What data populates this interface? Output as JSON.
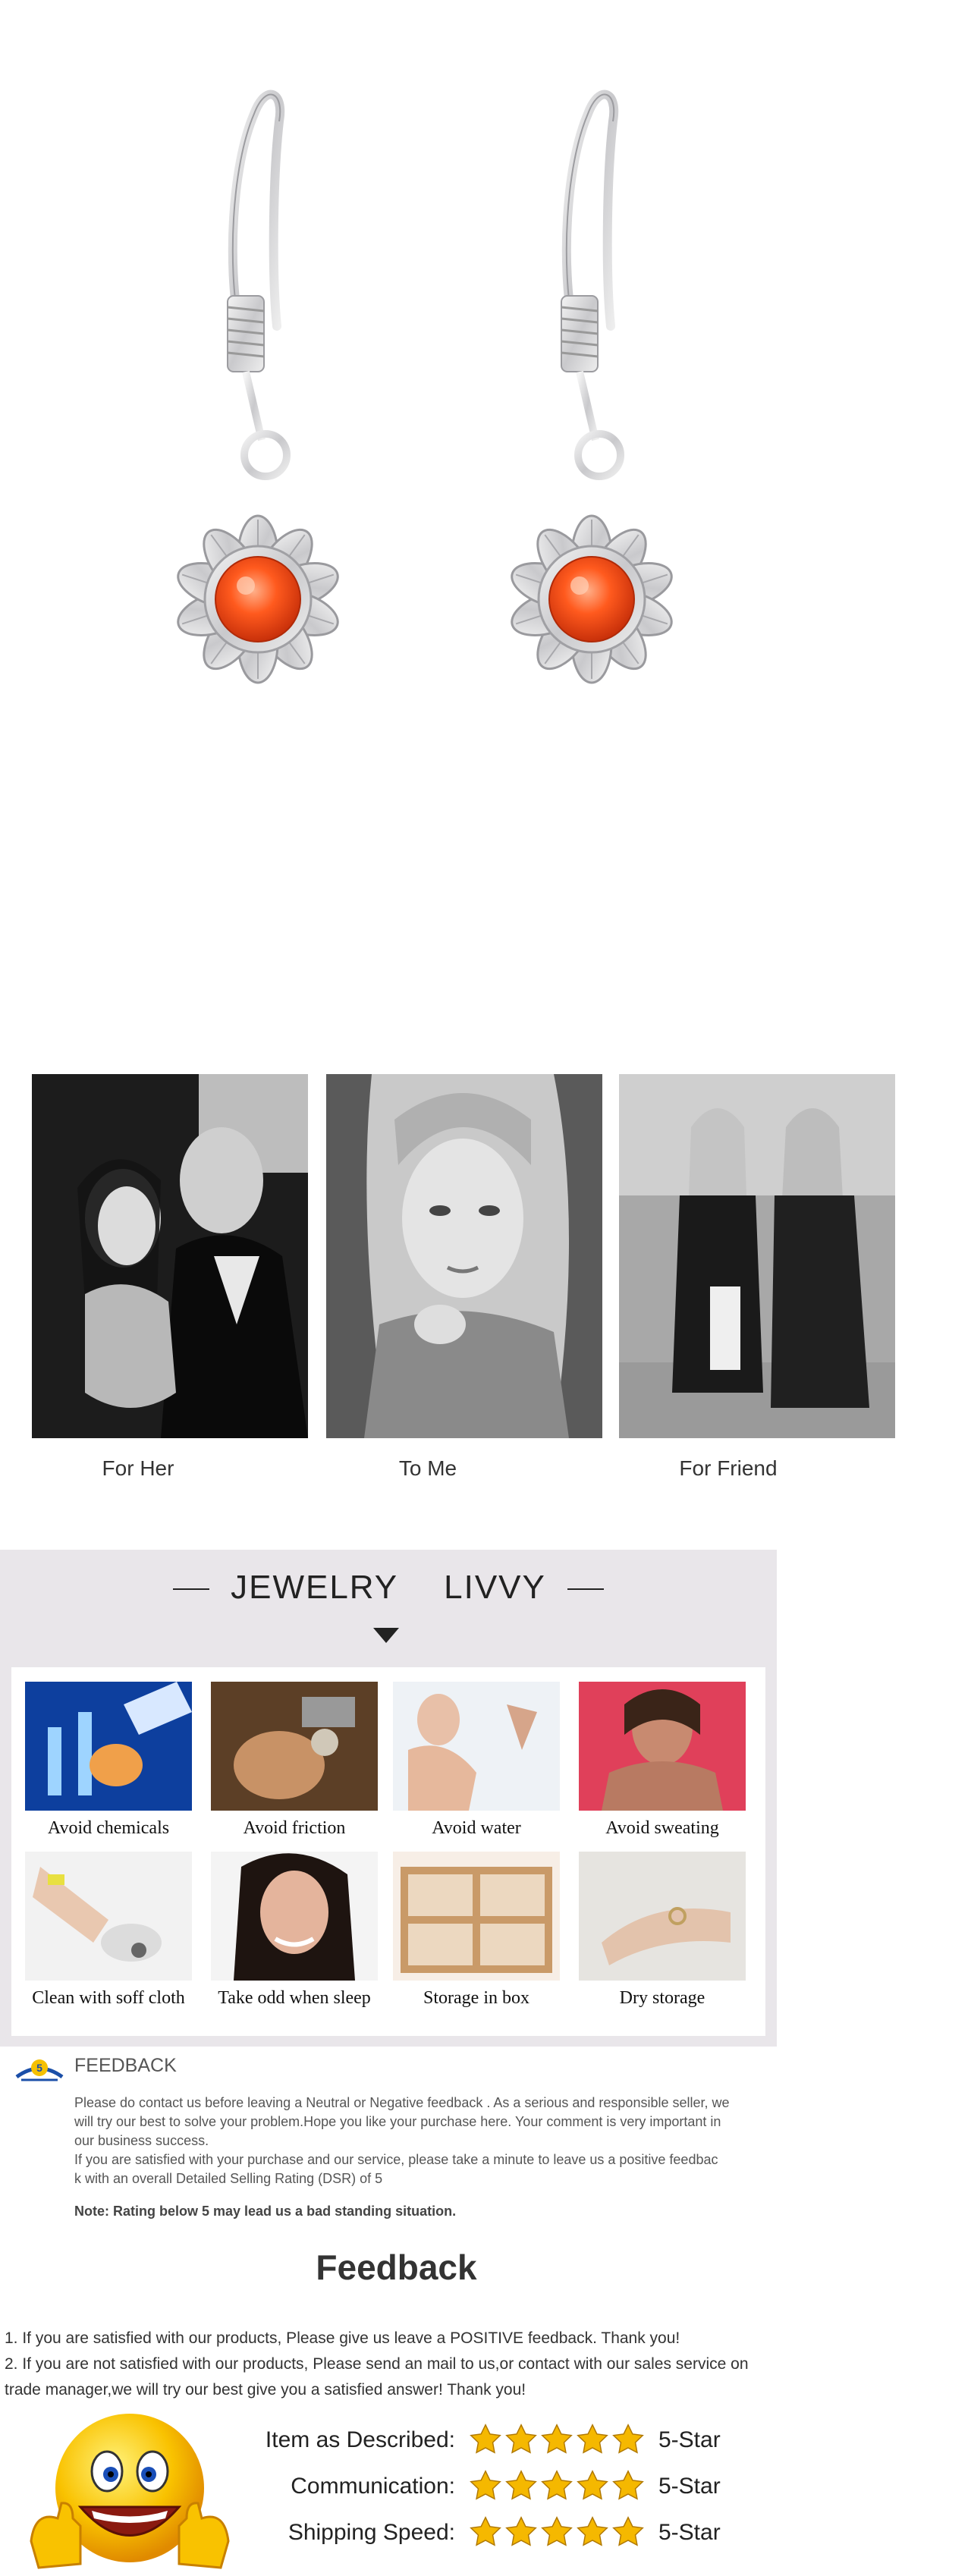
{
  "photo_section": {
    "captions": [
      "For Her",
      "To Me",
      "For Friend"
    ]
  },
  "care": {
    "title_left": "JEWELRY",
    "title_right": "LIVVY",
    "tiles": [
      {
        "label": "Avoid chemicals"
      },
      {
        "label": "Avoid friction"
      },
      {
        "label": "Avoid water"
      },
      {
        "label": "Avoid sweating"
      },
      {
        "label": "Clean with soff cloth"
      },
      {
        "label": "Take odd when sleep"
      },
      {
        "label": "Storage in box"
      },
      {
        "label": "Dry storage"
      }
    ]
  },
  "feedback": {
    "heading": "FEEDBACK",
    "body": "Please do contact us before leaving a Neutral or Negative  feedback . As a serious and responsible seller, we\nwill try our best to solve your problem.Hope you like your purchase here. Your comment is very important in\nour business success.\n If you are satisfied with your purchase and our service,  please take a minute to leave us  a positive feedbac\nk with an overall  Detailed Selling Rating (DSR) of 5",
    "note": "Note: Rating below 5 may lead us a bad standing situation.",
    "big_title": "Feedback",
    "line1": "1. If you are satisfied with our products, Please give us leave a POSITIVE feedback. Thank you!",
    "line2": "2. If you are not satisfied with our products, Please send an mail to us,or contact with our sales service on",
    "line3": "trade manager,we will try our best give you a satisfied answer! Thank you!",
    "ratings": [
      {
        "label": "Item as Described:",
        "stars": 5,
        "value": "5-Star"
      },
      {
        "label": "Communication:",
        "stars": 5,
        "value": "5-Star"
      },
      {
        "label": "Shipping Speed:",
        "stars": 5,
        "value": "5-Star"
      }
    ],
    "star_color": "#f5b800"
  }
}
